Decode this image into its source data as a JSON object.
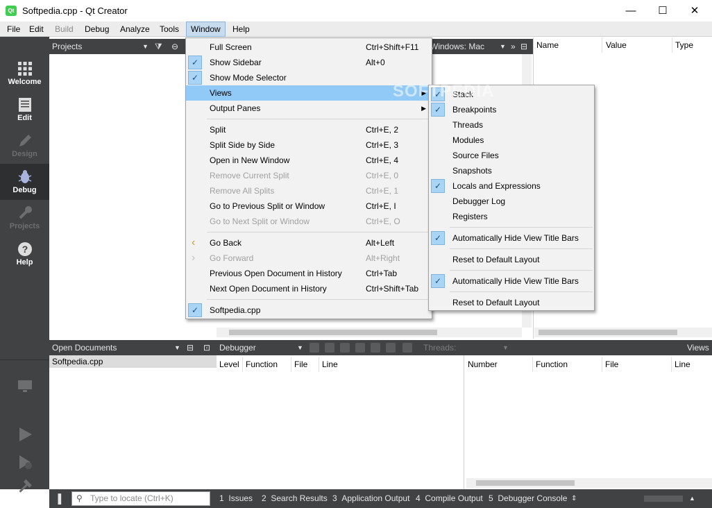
{
  "window": {
    "title": "Softpedia.cpp - Qt Creator",
    "app_icon_label": "Qt",
    "controls": {
      "minimize": "—",
      "maximize": "☐",
      "close": "✕"
    }
  },
  "menubar": [
    {
      "label": "File",
      "disabled": false
    },
    {
      "label": "Edit",
      "disabled": false
    },
    {
      "label": "Build",
      "disabled": true
    },
    {
      "label": "Debug",
      "disabled": false
    },
    {
      "label": "Analyze",
      "disabled": false
    },
    {
      "label": "Tools",
      "disabled": false
    },
    {
      "label": "Window",
      "disabled": false,
      "active": true
    },
    {
      "label": "Help",
      "disabled": false
    }
  ],
  "modes": [
    {
      "label": "Welcome",
      "icon": "grid-icon",
      "disabled": false
    },
    {
      "label": "Edit",
      "icon": "document-icon",
      "disabled": false
    },
    {
      "label": "Design",
      "icon": "pen-icon",
      "disabled": true
    },
    {
      "label": "Debug",
      "icon": "bug-icon",
      "disabled": false,
      "selected": true
    },
    {
      "label": "Projects",
      "icon": "wrench-icon",
      "disabled": true
    },
    {
      "label": "Help",
      "icon": "help-icon",
      "disabled": false
    }
  ],
  "projects_pane": {
    "title": "Projects"
  },
  "open_documents": {
    "title": "Open Documents",
    "items": [
      "Softpedia.cpp"
    ]
  },
  "locals_pane": {
    "columns": [
      "Name",
      "Value",
      "Type"
    ]
  },
  "editor_toolbar": {
    "kit": "Windows: Mac"
  },
  "debugger_bar": {
    "title": "Debugger",
    "threads_label": "Threads:",
    "views_label": "Views"
  },
  "stack_pane": {
    "columns": [
      "Level",
      "Function",
      "File",
      "Line"
    ]
  },
  "breakpoints_pane": {
    "columns": [
      "Number",
      "Function",
      "File",
      "Line"
    ]
  },
  "statusbar": {
    "locate_placeholder": "Type to locate (Ctrl+K)",
    "panes": [
      {
        "num": "1",
        "label": "Issues"
      },
      {
        "num": "2",
        "label": "Search Results"
      },
      {
        "num": "3",
        "label": "Application Output"
      },
      {
        "num": "4",
        "label": "Compile Output"
      },
      {
        "num": "5",
        "label": "Debugger Console"
      }
    ]
  },
  "window_menu": [
    {
      "label": "Full Screen",
      "shortcut": "Ctrl+Shift+F11"
    },
    {
      "label": "Show Sidebar",
      "shortcut": "Alt+0",
      "checked": true
    },
    {
      "label": "Show Mode Selector",
      "shortcut": "",
      "checked": true
    },
    {
      "label": "Views",
      "submenu": true,
      "highlighted": true
    },
    {
      "label": "Output Panes",
      "submenu": true
    },
    {
      "separator": true
    },
    {
      "label": "Split",
      "shortcut": "Ctrl+E, 2"
    },
    {
      "label": "Split Side by Side",
      "shortcut": "Ctrl+E, 3"
    },
    {
      "label": "Open in New Window",
      "shortcut": "Ctrl+E, 4"
    },
    {
      "label": "Remove Current Split",
      "shortcut": "Ctrl+E, 0",
      "disabled": true
    },
    {
      "label": "Remove All Splits",
      "shortcut": "Ctrl+E, 1",
      "disabled": true
    },
    {
      "label": "Go to Previous Split or Window",
      "shortcut": "Ctrl+E, I"
    },
    {
      "label": "Go to Next Split or Window",
      "shortcut": "Ctrl+E, O",
      "disabled": true
    },
    {
      "separator": true
    },
    {
      "label": "Go Back",
      "shortcut": "Alt+Left",
      "icon": "‹"
    },
    {
      "label": "Go Forward",
      "shortcut": "Alt+Right",
      "disabled": true,
      "icon": "›"
    },
    {
      "label": "Previous Open Document in History",
      "shortcut": "Ctrl+Tab"
    },
    {
      "label": "Next Open Document in History",
      "shortcut": "Ctrl+Shift+Tab"
    },
    {
      "separator": true
    },
    {
      "label": "Softpedia.cpp",
      "shortcut": "",
      "checked": true
    }
  ],
  "views_submenu": [
    {
      "label": "Stack",
      "checked": true
    },
    {
      "label": "Breakpoints",
      "checked": true
    },
    {
      "label": "Threads"
    },
    {
      "label": "Modules"
    },
    {
      "label": "Source Files"
    },
    {
      "label": "Snapshots"
    },
    {
      "label": "Locals and Expressions",
      "checked": true
    },
    {
      "label": "Debugger Log"
    },
    {
      "label": "Registers"
    },
    {
      "separator": true
    },
    {
      "label": "Automatically Hide View Title Bars",
      "checked": true
    },
    {
      "separator": true
    },
    {
      "label": "Reset to Default Layout"
    },
    {
      "separator": true
    },
    {
      "label": "Automatically Hide View Title Bars",
      "checked": true
    },
    {
      "separator": true
    },
    {
      "label": "Reset to Default Layout"
    }
  ],
  "watermark": "SOFTPEDIA",
  "colors": {
    "dark_panel": "#404244",
    "menu_highlight": "#91c9f7",
    "check_bg": "#a9d4f5"
  }
}
